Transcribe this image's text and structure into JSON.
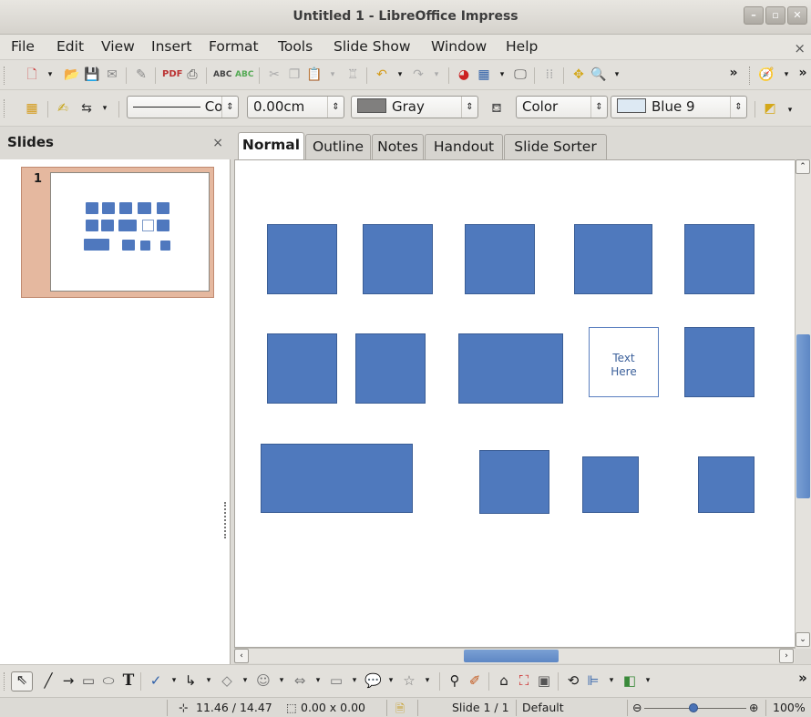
{
  "window": {
    "title": "Untitled 1 - LibreOffice Impress",
    "controls": [
      "minimize-icon",
      "maximize-icon",
      "close-icon"
    ]
  },
  "menubar": {
    "items": [
      "File",
      "Edit",
      "View",
      "Insert",
      "Format",
      "Tools",
      "Slide Show",
      "Window",
      "Help"
    ],
    "close_glyph": "×"
  },
  "toolbar_standard": {
    "overflow": "»"
  },
  "toolbar_line_fill": {
    "line_style_value": "Co",
    "line_width_value": "0.00cm",
    "line_color_value": "Gray",
    "line_color_hex": "#807f7e",
    "area_style_value": "Color",
    "area_color_value": "Blue 9",
    "area_color_hex": "#dde9f3"
  },
  "slides_pane": {
    "title": "Slides",
    "close_glyph": "×",
    "slides": [
      {
        "number": "1"
      }
    ]
  },
  "tabs": {
    "items": [
      "Normal",
      "Outline",
      "Notes",
      "Handout",
      "Slide Sorter"
    ],
    "active": "Normal"
  },
  "canvas": {
    "shape_fill": "#4f79bd",
    "text_box": {
      "line1": "Text",
      "line2": "Here"
    }
  },
  "statusbar": {
    "position": "11.46 / 14.47",
    "size": "0.00 x 0.00",
    "slide": "Slide 1 / 1",
    "layout": "Default",
    "zoom": "100%"
  }
}
